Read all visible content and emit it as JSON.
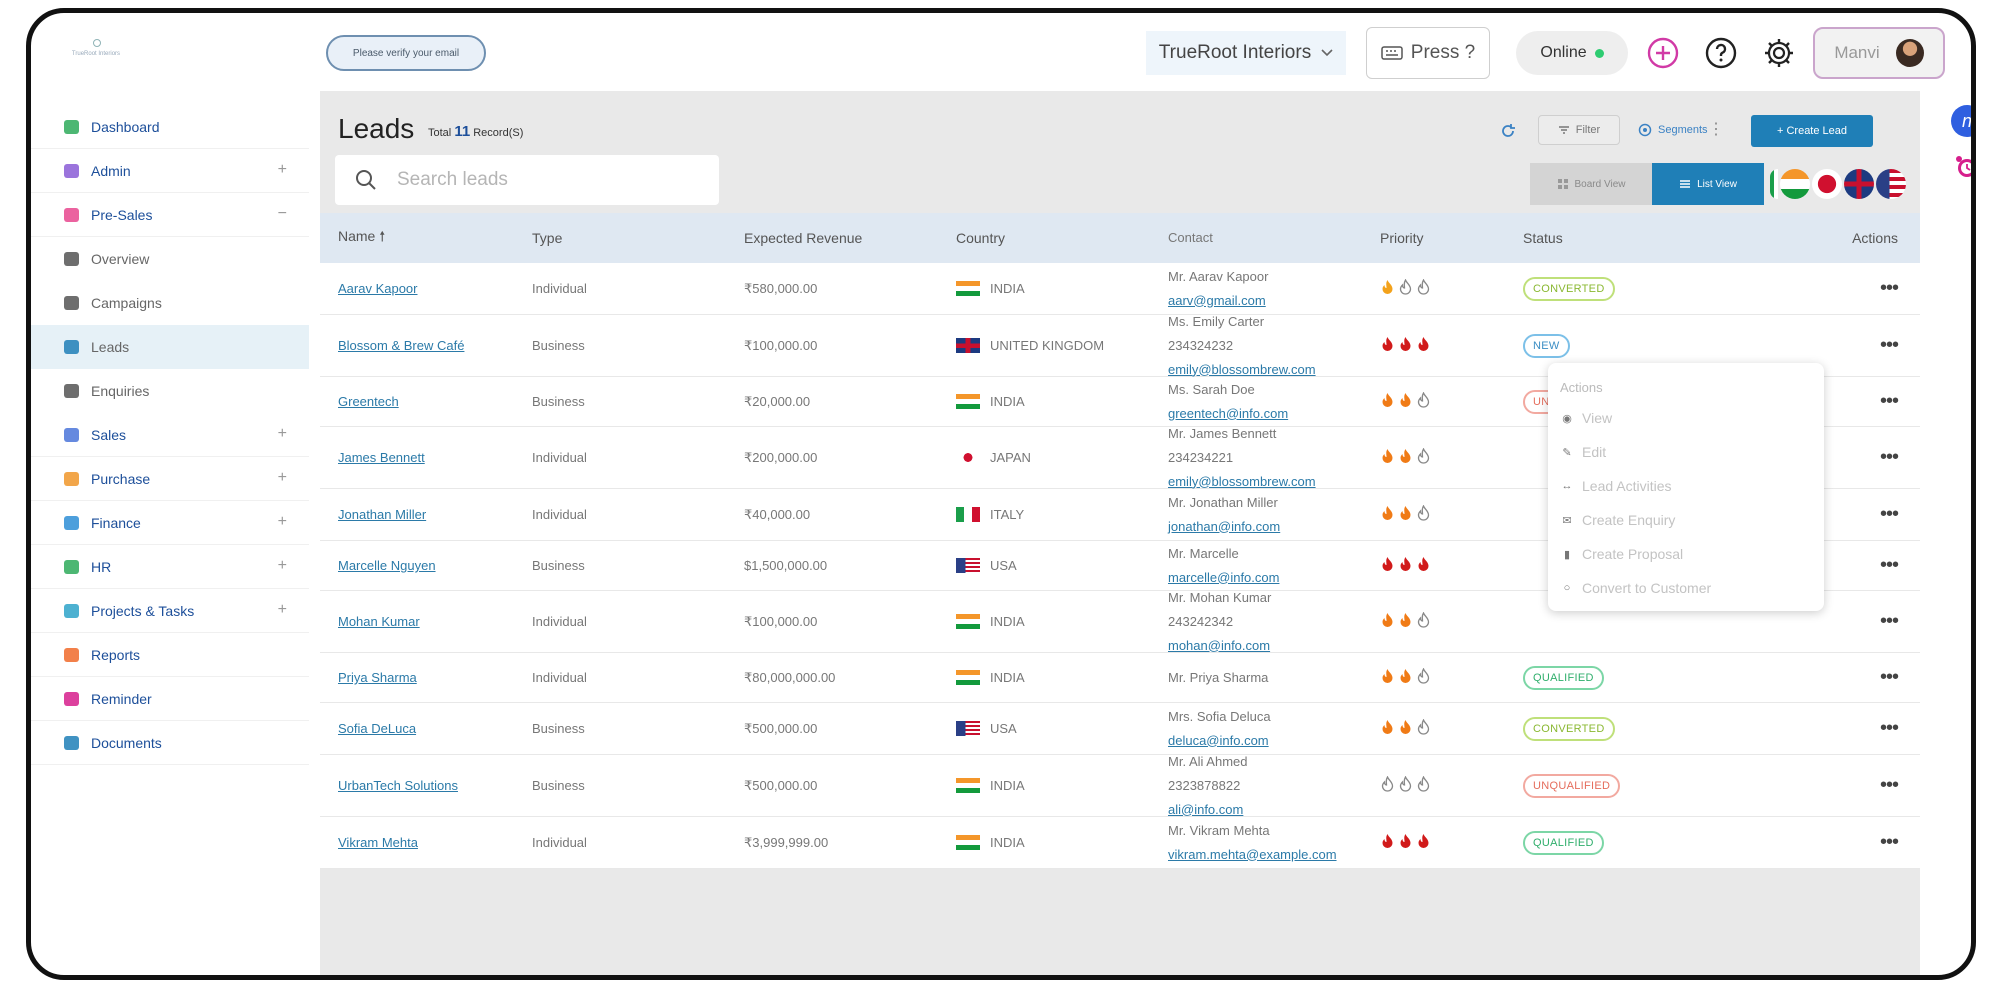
{
  "colors": {
    "brand": "#1f7fb7",
    "link": "#2b7aa8",
    "sidebar_text": "#1d4f9a",
    "online": "#2ecc71"
  },
  "topbar": {
    "logo_text": "TrueRoot Interiors",
    "verify_text": "Please verify your email",
    "org_name": "TrueRoot Interiors",
    "press_label": "Press ?",
    "online_label": "Online",
    "user_name": "Manvi",
    "icons": [
      "plus-circle-icon",
      "help-icon",
      "gear-icon"
    ]
  },
  "sidebar": {
    "items": [
      {
        "label": "Dashboard",
        "icon": "dashboard-icon",
        "toggle": ""
      },
      {
        "label": "Admin",
        "icon": "admin-icon",
        "toggle": "+"
      },
      {
        "label": "Pre-Sales",
        "icon": "clipboard-icon",
        "toggle": "−"
      },
      {
        "label": "Overview",
        "icon": "grid-icon",
        "toggle": "",
        "sub": true
      },
      {
        "label": "Campaigns",
        "icon": "megaphone-icon",
        "toggle": "",
        "sub": true
      },
      {
        "label": "Leads",
        "icon": "person-icon",
        "toggle": "",
        "sub": true,
        "active": true
      },
      {
        "label": "Enquiries",
        "icon": "mail-icon",
        "toggle": "",
        "sub": true
      },
      {
        "label": "Sales",
        "icon": "sales-icon",
        "toggle": "+"
      },
      {
        "label": "Purchase",
        "icon": "purchase-icon",
        "toggle": "+"
      },
      {
        "label": "Finance",
        "icon": "finance-icon",
        "toggle": "+"
      },
      {
        "label": "HR",
        "icon": "hr-icon",
        "toggle": "+"
      },
      {
        "label": "Projects & Tasks",
        "icon": "projects-icon",
        "toggle": "+"
      },
      {
        "label": "Reports",
        "icon": "reports-icon",
        "toggle": ""
      },
      {
        "label": "Reminder",
        "icon": "reminder-icon",
        "toggle": ""
      },
      {
        "label": "Documents",
        "icon": "documents-icon",
        "toggle": ""
      }
    ]
  },
  "leads": {
    "title": "Leads",
    "total_prefix": "Total",
    "total_count": "11",
    "total_suffix": "Record(S)",
    "search_placeholder": "Search leads",
    "filter_label": "Filter",
    "segments_label": "Segments",
    "create_label": "+ Create Lead",
    "board_view_label": "Board View",
    "list_view_label": "List View",
    "columns": [
      "Name",
      "Type",
      "Expected Revenue",
      "Country",
      "Contact",
      "Priority",
      "Status",
      "Actions"
    ],
    "rows": [
      {
        "name": "Aarav Kapoor",
        "type": "Individual",
        "revenue": "₹580,000.00",
        "flag": "in",
        "country": "INDIA",
        "contact": [
          "Mr. Aarav Kapoor",
          "aarv@gmail.com"
        ],
        "priority": [
          1,
          0,
          0
        ],
        "status": "CONVERTED"
      },
      {
        "name": "Blossom & Brew Café",
        "type": "Business",
        "revenue": "₹100,000.00",
        "flag": "uk",
        "country": "UNITED KINGDOM",
        "contact": [
          "Ms. Emily Carter",
          "234324232",
          "emily@blossombrew.com"
        ],
        "priority": [
          3,
          3,
          3
        ],
        "status": "NEW"
      },
      {
        "name": "Greentech",
        "type": "Business",
        "revenue": "₹20,000.00",
        "flag": "in",
        "country": "INDIA",
        "contact": [
          "Ms. Sarah Doe",
          "greentech@info.com"
        ],
        "priority": [
          2,
          2,
          0
        ],
        "status": "UNQUALIFIED"
      },
      {
        "name": "James Bennett",
        "type": "Individual",
        "revenue": "₹200,000.00",
        "flag": "jp",
        "country": "JAPAN",
        "contact": [
          "Mr. James Bennett",
          "234234221",
          "emily@blossombrew.com"
        ],
        "priority": [
          2,
          2,
          0
        ],
        "status": ""
      },
      {
        "name": "Jonathan Miller",
        "type": "Individual",
        "revenue": "₹40,000.00",
        "flag": "it",
        "country": "ITALY",
        "contact": [
          "Mr. Jonathan Miller",
          "jonathan@info.com"
        ],
        "priority": [
          2,
          2,
          0
        ],
        "status": ""
      },
      {
        "name": "Marcelle Nguyen",
        "type": "Business",
        "revenue": "$1,500,000.00",
        "flag": "us",
        "country": "USA",
        "contact": [
          "Mr. Marcelle",
          "marcelle@info.com"
        ],
        "priority": [
          3,
          3,
          3
        ],
        "status": ""
      },
      {
        "name": "Mohan Kumar",
        "type": "Individual",
        "revenue": "₹100,000.00",
        "flag": "in",
        "country": "INDIA",
        "contact": [
          "Mr. Mohan Kumar",
          "243242342",
          "mohan@info.com"
        ],
        "priority": [
          2,
          2,
          0
        ],
        "status": ""
      },
      {
        "name": "Priya Sharma",
        "type": "Individual",
        "revenue": "₹80,000,000.00",
        "flag": "in",
        "country": "INDIA",
        "contact": [
          "Mr. Priya Sharma"
        ],
        "priority": [
          2,
          2,
          0
        ],
        "status": "QUALIFIED"
      },
      {
        "name": "Sofia DeLuca",
        "type": "Business",
        "revenue": "₹500,000.00",
        "flag": "us",
        "country": "USA",
        "contact": [
          "Mrs. Sofia Deluca",
          "deluca@info.com"
        ],
        "priority": [
          2,
          2,
          0
        ],
        "status": "CONVERTED"
      },
      {
        "name": "UrbanTech Solutions",
        "type": "Business",
        "revenue": "₹500,000.00",
        "flag": "in",
        "country": "INDIA",
        "contact": [
          "Mr. Ali Ahmed",
          "2323878822",
          "ali@info.com"
        ],
        "priority": [
          0,
          0,
          0
        ],
        "status": "UNQUALIFIED"
      },
      {
        "name": "Vikram Mehta",
        "type": "Individual",
        "revenue": "₹3,999,999.00",
        "flag": "in",
        "country": "INDIA",
        "contact": [
          "Mr. Vikram Mehta",
          "vikram.mehta@example.com"
        ],
        "priority": [
          3,
          3,
          3
        ],
        "status": "QUALIFIED"
      }
    ]
  },
  "actions_menu": {
    "title": "Actions",
    "items": [
      {
        "label": "View",
        "icon": "eye-icon"
      },
      {
        "label": "Edit",
        "icon": "pencil-icon"
      },
      {
        "label": "Lead Activities",
        "icon": "arrows-icon"
      },
      {
        "label": "Create Enquiry",
        "icon": "envelope-icon"
      },
      {
        "label": "Create Proposal",
        "icon": "document-icon"
      },
      {
        "label": "Convert to Customer",
        "icon": "convert-icon"
      }
    ]
  }
}
